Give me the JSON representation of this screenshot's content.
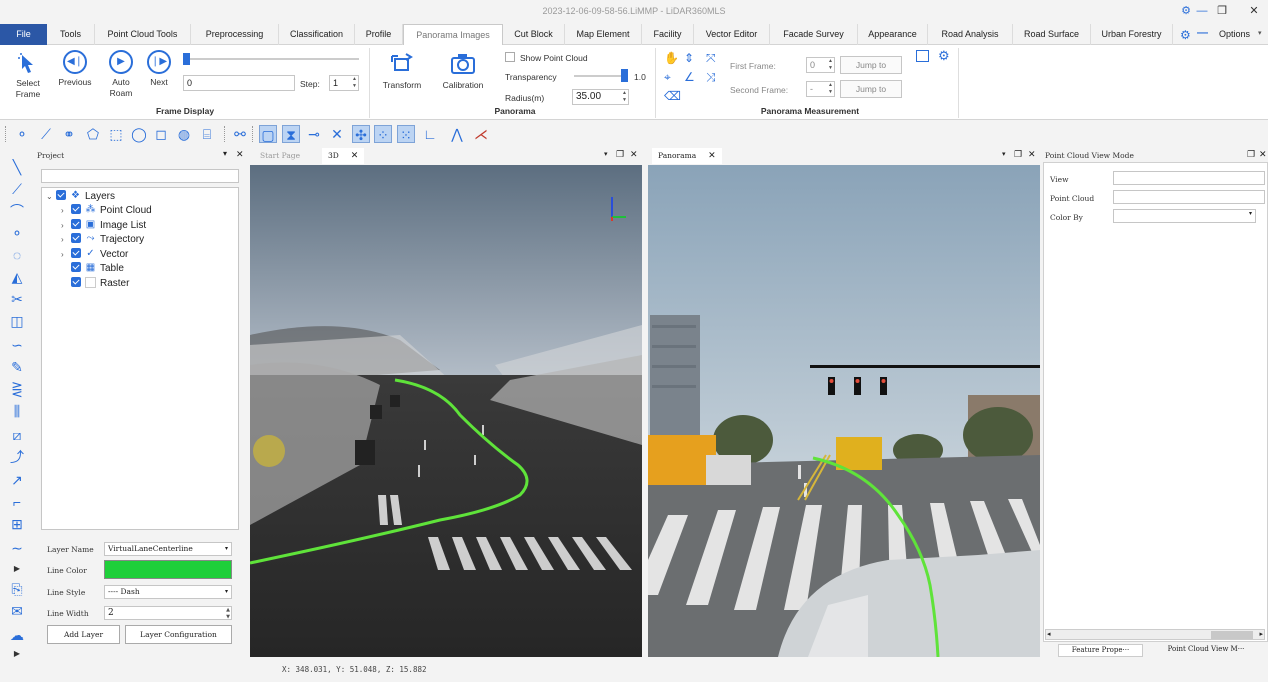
{
  "window": {
    "title": "2023-12-06-09-58-56.LiMMP - LiDAR360MLS",
    "settings_glyph": "⚙",
    "minimize_glyph": "—",
    "maximize_glyph": "❐",
    "close_glyph": "✕"
  },
  "tabs": [
    "File",
    "Tools",
    "Point Cloud Tools",
    "Preprocessing",
    "Classification",
    "Profile",
    "Panorama Images",
    "Cut Block",
    "Map Element",
    "Facility",
    "Vector Editor",
    "Facade Survey",
    "Appearance",
    "Road Analysis",
    "Road Surface",
    "Urban Forestry"
  ],
  "active_tab": "Panorama Images",
  "options_label": "Options",
  "ribbon": {
    "frame_display": {
      "label": "Frame Display",
      "select_frame": "Select\nFrame",
      "previous": "Previous",
      "auto_roam": "Auto\nRoam",
      "next": "Next",
      "frame_value": "0",
      "step_label": "Step:",
      "step_value": "1",
      "slider_value": 0.0
    },
    "panorama": {
      "label": "Panorama",
      "transform": "Transform",
      "calibration": "Calibration",
      "show_point_cloud": "Show Point Cloud",
      "show_point_cloud_checked": false,
      "transparency_label": "Transparency",
      "transparency_value": "1.0",
      "transparency_level": 1.0,
      "radius_label": "Radius(m)",
      "radius_value": "35.00"
    },
    "measurement": {
      "label": "Panorama Measurement",
      "first_frame_label": "First Frame:",
      "first_frame_value": "0",
      "second_frame_label": "Second Frame:",
      "second_frame_value": "-",
      "jump_to": "Jump to"
    }
  },
  "project": {
    "title": "Project",
    "search_value": "",
    "layers": [
      {
        "label": "Layers",
        "icon": "layers-icon",
        "expandable": true,
        "expanded": true
      },
      {
        "label": "Point Cloud",
        "icon": "point-cloud-icon",
        "expandable": true
      },
      {
        "label": "Image List",
        "icon": "image-list-icon",
        "expandable": true
      },
      {
        "label": "Trajectory",
        "icon": "trajectory-icon",
        "expandable": true
      },
      {
        "label": "Vector",
        "icon": "vector-icon",
        "expandable": true
      },
      {
        "label": "Table",
        "icon": "table-icon",
        "expandable": false
      },
      {
        "label": "Raster",
        "icon": "raster-icon",
        "expandable": false
      }
    ],
    "layer_name_label": "Layer Name",
    "layer_name_value": "VirtualLaneCenterline",
    "line_color_label": "Line Color",
    "line_color": "#1fcf3a",
    "line_style_label": "Line Style",
    "line_style_value": "---- Dash",
    "line_width_label": "Line Width",
    "line_width_value": "2",
    "add_layer": "Add Layer",
    "layer_configuration": "Layer Configuration"
  },
  "view3d": {
    "tabs": [
      "Start Page",
      "3D"
    ],
    "active": "3D"
  },
  "panorama_view": {
    "tabs": [
      "Panorama"
    ]
  },
  "right_panel": {
    "title": "Point Cloud View Mode",
    "view_label": "View",
    "point_cloud_label": "Point Cloud",
    "color_by_label": "Color By",
    "bottom_tabs": [
      "Feature Prope···",
      "Point Cloud View M···"
    ]
  },
  "status": {
    "coords": "X: 348.031, Y: 51.048, Z: 15.882"
  },
  "colors": {
    "accent": "#2b57a6",
    "icon_blue": "#2a6ed9",
    "trajectory": "#5fe33a"
  }
}
